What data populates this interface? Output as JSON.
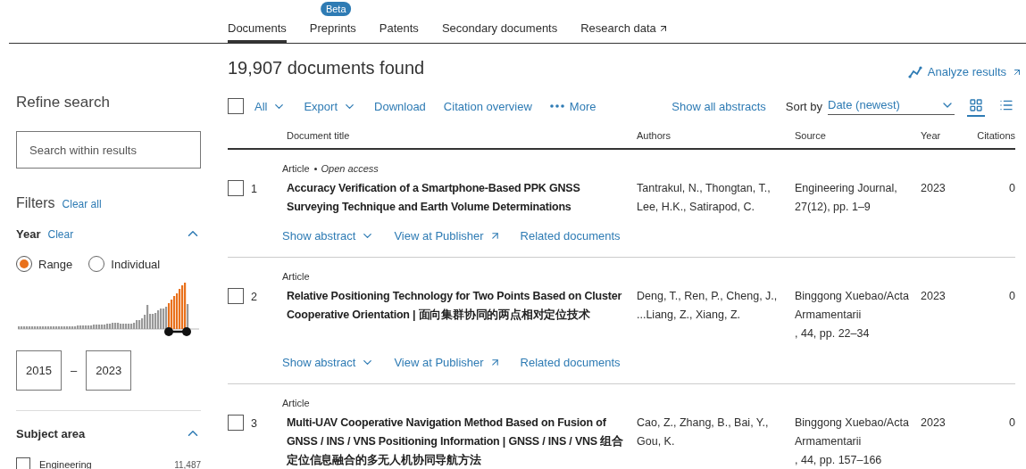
{
  "tabs": [
    {
      "label": "Documents",
      "selected": true
    },
    {
      "label": "Preprints",
      "selected": false,
      "badge": "Beta"
    },
    {
      "label": "Patents",
      "selected": false
    },
    {
      "label": "Secondary documents",
      "selected": false
    },
    {
      "label": "Research data",
      "selected": false,
      "external": true
    }
  ],
  "sidebar": {
    "title": "Refine search",
    "search": {
      "placeholder": "Search within results"
    },
    "filters_title": "Filters",
    "clear_all": "Clear all",
    "year": {
      "title": "Year",
      "clear": "Clear",
      "expanded": true,
      "modes": [
        {
          "label": "Range",
          "selected": true
        },
        {
          "label": "Individual",
          "selected": false
        }
      ],
      "from": "2015",
      "to": "2023",
      "separator": "–"
    },
    "subject_area": {
      "title": "Subject area",
      "expanded": true,
      "items": [
        {
          "label": "Engineering",
          "count": "11,487",
          "checked": false
        }
      ]
    }
  },
  "results": {
    "count_title": "19,907 documents found",
    "analyze": "Analyze results",
    "toolbar": {
      "select_all": {
        "checked": false
      },
      "actions": [
        {
          "label": "All",
          "kind": "dropdown"
        },
        {
          "label": "Export",
          "kind": "dropdown"
        },
        {
          "label": "Download",
          "kind": "plain"
        },
        {
          "label": "Citation overview",
          "kind": "plain"
        },
        {
          "label": "More",
          "kind": "more"
        }
      ],
      "show_all_abstracts": "Show all abstracts",
      "sort_label": "Sort by",
      "sort_value": "Date (newest)",
      "views": [
        {
          "kind": "grid",
          "selected": true
        },
        {
          "kind": "list",
          "selected": false
        }
      ]
    },
    "columns": [
      "Document title",
      "Authors",
      "Source",
      "Year",
      "Citations"
    ],
    "rows": [
      {
        "number": "1",
        "checked": false,
        "type": "Article",
        "access": "Open access",
        "title": "Accuracy Verification of a Smartphone-Based PPK GNSS Surveying Technique and Earth Volume Determinations",
        "authors": [
          "Tantrakul, N., Thongtan, T.,",
          "Lee, H.K., Satirapod, C."
        ],
        "source": [
          "Engineering Journal,",
          "27(12), pp. 1–9"
        ],
        "year": "2023",
        "citations": "0",
        "links": [
          {
            "label": "Show abstract",
            "kind": "expand"
          },
          {
            "label": "View at Publisher",
            "kind": "external"
          },
          {
            "label": "Related documents",
            "kind": "plain"
          }
        ]
      },
      {
        "number": "2",
        "checked": false,
        "type": "Article",
        "title": "Relative Positioning Technology for Two Points Based on Cluster Cooperative Orientation | 面向集群协同的两点相对定位技术",
        "authors": [
          "Deng, T., Ren, P., Cheng, J.,",
          "...Liang, Z., Xiang, Z."
        ],
        "source": [
          "Binggong Xuebao/Acta",
          "Armamentarii",
          ", 44, pp. 22–34"
        ],
        "year": "2023",
        "citations": "0",
        "links": [
          {
            "label": "Show abstract",
            "kind": "expand"
          },
          {
            "label": "View at Publisher",
            "kind": "external"
          },
          {
            "label": "Related documents",
            "kind": "plain"
          }
        ]
      },
      {
        "number": "3",
        "checked": false,
        "type": "Article",
        "title": "Multi-UAV Cooperative Navigation Method Based on Fusion of GNSS / INS / VNS Positioning Information | GNSS / INS / VNS 组合定位信息融合的多无人机协同导航方法",
        "authors": [
          "Cao, Z., Zhang, B., Bai, Y.,",
          "Gou, K."
        ],
        "source": [
          "Binggong Xuebao/Acta",
          "Armamentarii",
          ", 44, pp. 157–166"
        ],
        "year": "2023",
        "citations": "0"
      }
    ]
  }
}
